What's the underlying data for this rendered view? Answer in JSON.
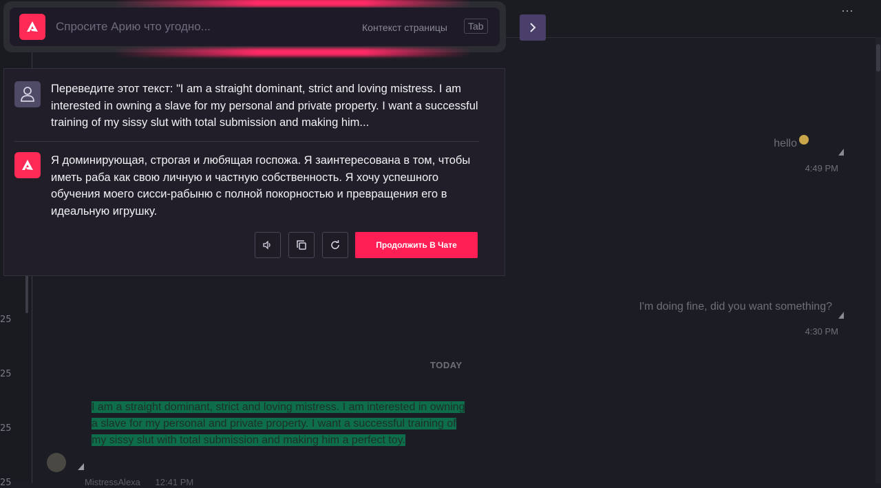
{
  "assistant": {
    "search_placeholder": "Спросите Арию что угодно...",
    "context_label": "Контекст страницы",
    "tab_key": "Tab",
    "user_message": "Переведите этот текст: \"I am a straight dominant, strict and loving mistress. I am interested in owning a slave for my personal and private property. I want a successful training of my sissy slut with total submission and making him...",
    "assistant_reply": "Я доминирующая, строгая и любящая госпожа. Я заинтересована в том, чтобы иметь раба как свою личную и частную собственность. Я хочу успешного обучения моего сисси-рабыню с полной покорностью и превращения его в идеальную игрушку.",
    "continue_label": "Продолжить В Чате",
    "icons": [
      "logo-icon",
      "user-icon",
      "speaker-icon",
      "copy-icon",
      "refresh-icon",
      "chevron-right-icon"
    ],
    "accent": "#ff2a55"
  },
  "chat": {
    "messages": [
      {
        "text": "hello",
        "time": "4:49 PM"
      },
      {
        "text": "I'm doing fine, did you want something?",
        "time": "4:30 PM"
      }
    ],
    "day_separator": "TODAY",
    "quoted_message": "I am a straight dominant, strict and loving mistress. I am interested in owning a slave for my personal and private property. I want a successful training of my sissy slut with total submission and making him a perfect toy.",
    "author": "MistressAlexa",
    "author_time": "12:41 PM",
    "highlight_color": "#0e6e4c"
  },
  "rail": {
    "numbers": [
      "25",
      "25",
      "25",
      "25"
    ]
  }
}
